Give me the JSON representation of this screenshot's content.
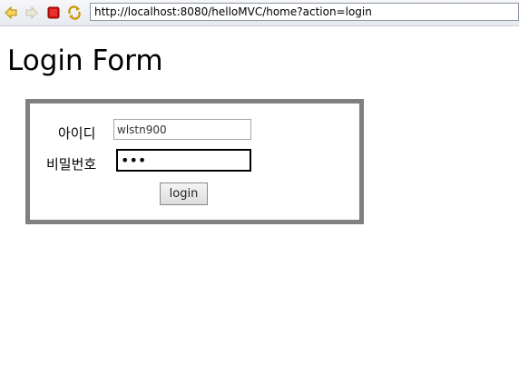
{
  "browser": {
    "url": "http://localhost:8080/helloMVC/home?action=login",
    "icons": {
      "back": "back-arrow-icon",
      "forward": "forward-arrow-icon",
      "stop": "stop-icon",
      "refresh": "refresh-icon"
    }
  },
  "page": {
    "title": "Login Form"
  },
  "form": {
    "id_label": "아이디",
    "id_value": "wlstn900",
    "password_label": "비밀번호",
    "password_value": "•••",
    "submit_label": "login"
  },
  "colors": {
    "box_border": "#808080",
    "stop_icon": "#d01010",
    "nav_arrow": "#e8b400"
  }
}
